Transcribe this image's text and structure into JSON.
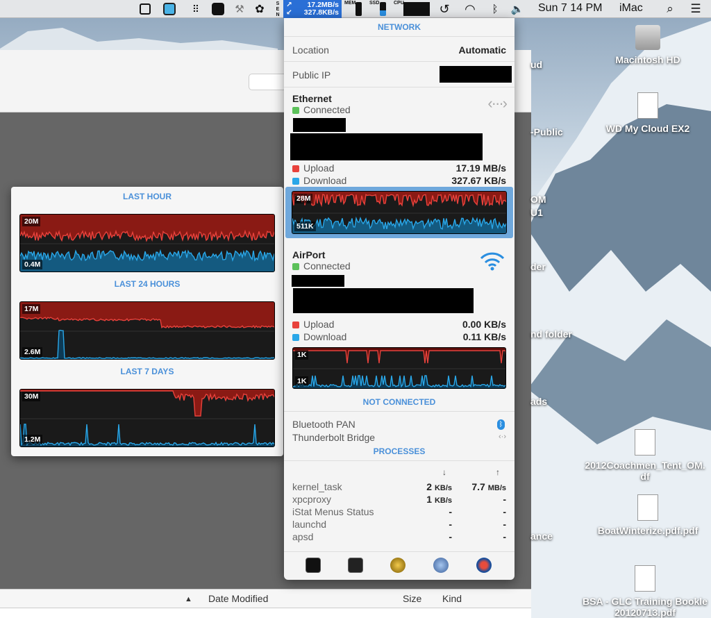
{
  "menubar": {
    "net_up": "17.2MB/s",
    "net_down": "327.8KB/s",
    "mem_label": "MEM",
    "ssd_label": "SSD",
    "cpu_label": "CPU",
    "clock": "Sun 7 14 PM",
    "user": "iMac"
  },
  "history": {
    "sections": [
      {
        "title": "LAST HOUR",
        "top_label": "20M",
        "bottom_label": "0.4M"
      },
      {
        "title": "LAST 24 HOURS",
        "top_label": "17M",
        "bottom_label": "2.6M"
      },
      {
        "title": "LAST 7 DAYS",
        "top_label": "30M",
        "bottom_label": "1.2M"
      }
    ]
  },
  "network": {
    "title": "NETWORK",
    "location_label": "Location",
    "location_value": "Automatic",
    "public_ip_label": "Public IP",
    "ethernet": {
      "name": "Ethernet",
      "status": "Connected",
      "upload_label": "Upload",
      "upload_value": "17.19 MB/s",
      "download_label": "Download",
      "download_value": "327.67 KB/s",
      "graph_top": "28M",
      "graph_bottom": "511K"
    },
    "airport": {
      "name": "AirPort",
      "status": "Connected",
      "upload_label": "Upload",
      "upload_value": "0.00 KB/s",
      "download_label": "Download",
      "download_value": "0.11 KB/s",
      "graph_top": "1K",
      "graph_bottom": "1K"
    },
    "not_connected_title": "NOT CONNECTED",
    "not_connected": [
      "Bluetooth PAN",
      "Thunderbolt Bridge"
    ],
    "processes_title": "PROCESSES",
    "processes": [
      {
        "name": "kernel_task",
        "down": "2",
        "down_unit": "KB/s",
        "up": "7.7",
        "up_unit": "MB/s"
      },
      {
        "name": "xpcproxy",
        "down": "1",
        "down_unit": "KB/s",
        "up": "-",
        "up_unit": ""
      },
      {
        "name": "iStat Menus Status",
        "down": "-",
        "down_unit": "",
        "up": "-",
        "up_unit": ""
      },
      {
        "name": "launchd",
        "down": "-",
        "down_unit": "",
        "up": "-",
        "up_unit": ""
      },
      {
        "name": "apsd",
        "down": "-",
        "down_unit": "",
        "up": "-",
        "up_unit": ""
      }
    ],
    "colors": {
      "upload": "#e8423c",
      "download": "#2aa7e8",
      "accent": "#4a90d9",
      "connected": "#5cc15a"
    }
  },
  "finder": {
    "columns": [
      "Date Modified",
      "Size",
      "Kind"
    ]
  },
  "desktop": {
    "icons": [
      "Macintosh HD",
      "WD My Cloud EX2",
      "2012Coachmen_Tent_OM.",
      "df",
      "BoatWinterize.pdf.pdf",
      "BSA - GLC Training Bookle",
      "20120713.pdf"
    ],
    "clipped": [
      "ud",
      "-Public",
      "OM",
      "U1",
      "der",
      "nd folder",
      "ads",
      "ance",
      "nce"
    ]
  }
}
